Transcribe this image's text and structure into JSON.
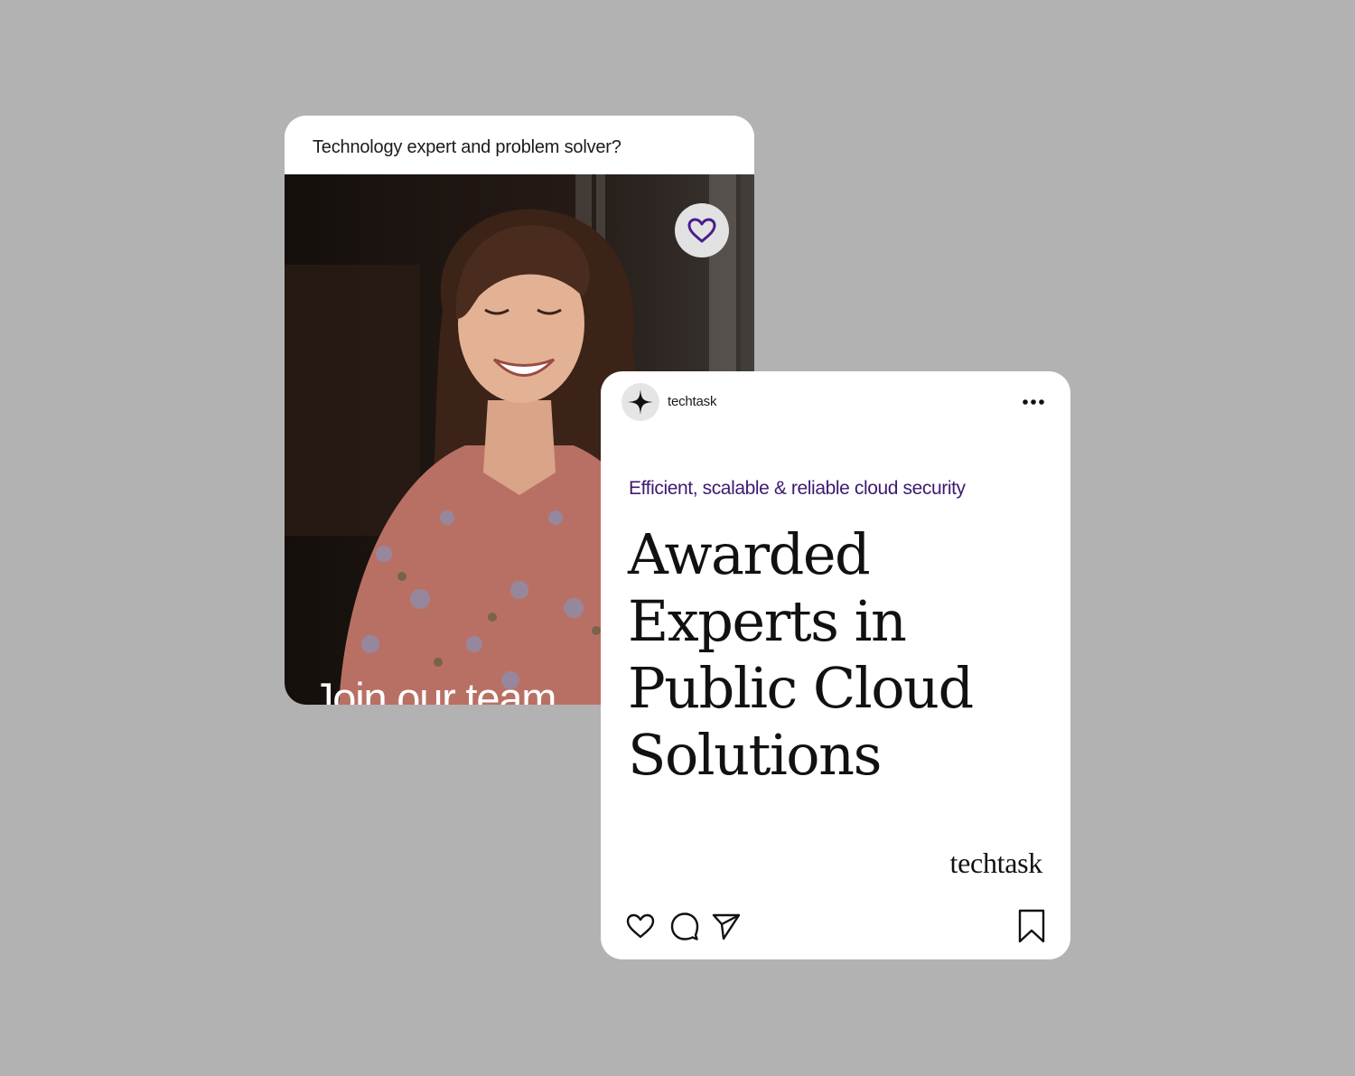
{
  "background_color": "#b2b2b2",
  "recruit_card": {
    "question": "Technology expert and problem solver?",
    "cta": "Join our team.",
    "like_icon": "heart-outline-icon",
    "accent_color": "#4a1d8c"
  },
  "post_card": {
    "account": {
      "name": "techtask",
      "avatar_icon": "four-point-star-icon"
    },
    "menu_icon": "more-horizontal-icon",
    "tagline": "Efficient, scalable & reliable cloud security",
    "tagline_color": "#3d1a72",
    "headline_lines": [
      "Awarded",
      "Experts in",
      "Public Cloud",
      "Solutions"
    ],
    "wordmark": "techtask",
    "actions": {
      "like_icon": "heart-icon",
      "comment_icon": "comment-icon",
      "share_icon": "send-icon",
      "save_icon": "bookmark-icon"
    }
  }
}
